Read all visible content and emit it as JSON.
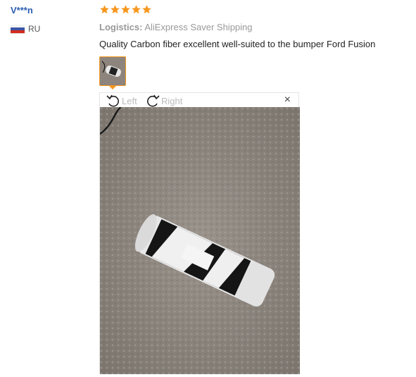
{
  "review": {
    "user": "V***n",
    "country_code": "RU",
    "rating": 5,
    "logistics_label": "Logistics:",
    "logistics_value": "AliExpress Saver Shipping",
    "text": "Quality Carbon fiber excellent well-suited to the bumper Ford Fusion"
  },
  "viewer": {
    "rotate_left_label": "Left",
    "rotate_right_label": "Right",
    "close_label": "×"
  },
  "colors": {
    "username": "#2a5db0",
    "star": "#f7971e",
    "thumb_border": "#f7971e"
  },
  "icons": {
    "rotate_left": "rotate-left-icon",
    "rotate_right": "rotate-right-icon",
    "close": "close-icon",
    "star": "star-icon",
    "flag": "russia-flag-icon"
  }
}
